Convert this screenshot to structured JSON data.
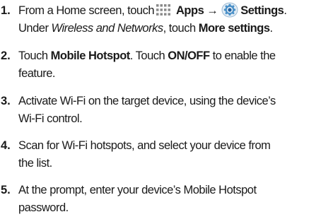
{
  "steps": [
    {
      "number": "1.",
      "line1": {
        "pre": "From a Home screen, touch",
        "apps_icon": "apps-grid-icon",
        "apps_label": "Apps",
        "arrow": "→",
        "settings_icon": "settings-gear-icon",
        "settings_label": "Settings",
        "post": "."
      },
      "line2": {
        "pre": "Under ",
        "section": "Wireless and Networks",
        "mid": ", touch ",
        "target": "More settings",
        "post": "."
      }
    },
    {
      "number": "2.",
      "line1": {
        "pre": "Touch ",
        "target": "Mobile Hotspot",
        "mid": ". Touch ",
        "toggle": "ON/OFF",
        "post": " to enable the"
      },
      "line2": "feature."
    },
    {
      "number": "3.",
      "line1": "Activate Wi-Fi on the target device, using the device’s",
      "line2": "Wi-Fi control."
    },
    {
      "number": "4.",
      "line1": "Scan for Wi-Fi hotspots, and select your device from",
      "line2": "the list."
    },
    {
      "number": "5.",
      "line1": "At the prompt, enter your device’s Mobile Hotspot",
      "line2": "password."
    }
  ],
  "colors": {
    "text": "#1a1a1a",
    "apps_icon": "#8a8a8a",
    "settings_icon_ring": "#4a90c8",
    "settings_icon_center": "#1f5f9e"
  }
}
